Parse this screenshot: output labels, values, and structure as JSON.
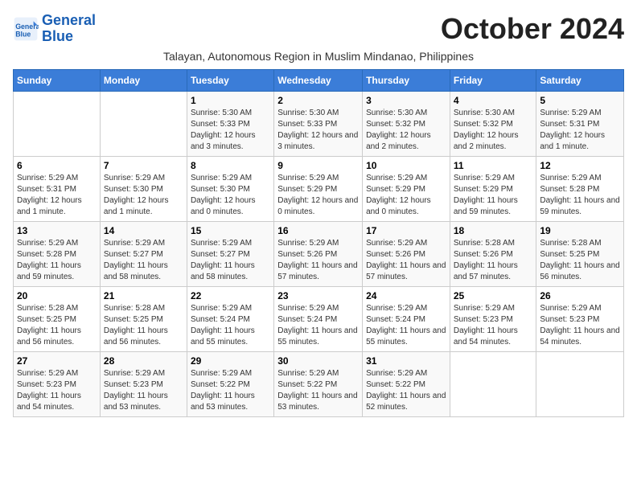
{
  "logo": {
    "line1": "General",
    "line2": "Blue"
  },
  "title": "October 2024",
  "location": "Talayan, Autonomous Region in Muslim Mindanao, Philippines",
  "headers": [
    "Sunday",
    "Monday",
    "Tuesday",
    "Wednesday",
    "Thursday",
    "Friday",
    "Saturday"
  ],
  "weeks": [
    [
      {
        "day": "",
        "info": ""
      },
      {
        "day": "",
        "info": ""
      },
      {
        "day": "1",
        "info": "Sunrise: 5:30 AM\nSunset: 5:33 PM\nDaylight: 12 hours and 3 minutes."
      },
      {
        "day": "2",
        "info": "Sunrise: 5:30 AM\nSunset: 5:33 PM\nDaylight: 12 hours and 3 minutes."
      },
      {
        "day": "3",
        "info": "Sunrise: 5:30 AM\nSunset: 5:32 PM\nDaylight: 12 hours and 2 minutes."
      },
      {
        "day": "4",
        "info": "Sunrise: 5:30 AM\nSunset: 5:32 PM\nDaylight: 12 hours and 2 minutes."
      },
      {
        "day": "5",
        "info": "Sunrise: 5:29 AM\nSunset: 5:31 PM\nDaylight: 12 hours and 1 minute."
      }
    ],
    [
      {
        "day": "6",
        "info": "Sunrise: 5:29 AM\nSunset: 5:31 PM\nDaylight: 12 hours and 1 minute."
      },
      {
        "day": "7",
        "info": "Sunrise: 5:29 AM\nSunset: 5:30 PM\nDaylight: 12 hours and 1 minute."
      },
      {
        "day": "8",
        "info": "Sunrise: 5:29 AM\nSunset: 5:30 PM\nDaylight: 12 hours and 0 minutes."
      },
      {
        "day": "9",
        "info": "Sunrise: 5:29 AM\nSunset: 5:29 PM\nDaylight: 12 hours and 0 minutes."
      },
      {
        "day": "10",
        "info": "Sunrise: 5:29 AM\nSunset: 5:29 PM\nDaylight: 12 hours and 0 minutes."
      },
      {
        "day": "11",
        "info": "Sunrise: 5:29 AM\nSunset: 5:29 PM\nDaylight: 11 hours and 59 minutes."
      },
      {
        "day": "12",
        "info": "Sunrise: 5:29 AM\nSunset: 5:28 PM\nDaylight: 11 hours and 59 minutes."
      }
    ],
    [
      {
        "day": "13",
        "info": "Sunrise: 5:29 AM\nSunset: 5:28 PM\nDaylight: 11 hours and 59 minutes."
      },
      {
        "day": "14",
        "info": "Sunrise: 5:29 AM\nSunset: 5:27 PM\nDaylight: 11 hours and 58 minutes."
      },
      {
        "day": "15",
        "info": "Sunrise: 5:29 AM\nSunset: 5:27 PM\nDaylight: 11 hours and 58 minutes."
      },
      {
        "day": "16",
        "info": "Sunrise: 5:29 AM\nSunset: 5:26 PM\nDaylight: 11 hours and 57 minutes."
      },
      {
        "day": "17",
        "info": "Sunrise: 5:29 AM\nSunset: 5:26 PM\nDaylight: 11 hours and 57 minutes."
      },
      {
        "day": "18",
        "info": "Sunrise: 5:28 AM\nSunset: 5:26 PM\nDaylight: 11 hours and 57 minutes."
      },
      {
        "day": "19",
        "info": "Sunrise: 5:28 AM\nSunset: 5:25 PM\nDaylight: 11 hours and 56 minutes."
      }
    ],
    [
      {
        "day": "20",
        "info": "Sunrise: 5:28 AM\nSunset: 5:25 PM\nDaylight: 11 hours and 56 minutes."
      },
      {
        "day": "21",
        "info": "Sunrise: 5:28 AM\nSunset: 5:25 PM\nDaylight: 11 hours and 56 minutes."
      },
      {
        "day": "22",
        "info": "Sunrise: 5:29 AM\nSunset: 5:24 PM\nDaylight: 11 hours and 55 minutes."
      },
      {
        "day": "23",
        "info": "Sunrise: 5:29 AM\nSunset: 5:24 PM\nDaylight: 11 hours and 55 minutes."
      },
      {
        "day": "24",
        "info": "Sunrise: 5:29 AM\nSunset: 5:24 PM\nDaylight: 11 hours and 55 minutes."
      },
      {
        "day": "25",
        "info": "Sunrise: 5:29 AM\nSunset: 5:23 PM\nDaylight: 11 hours and 54 minutes."
      },
      {
        "day": "26",
        "info": "Sunrise: 5:29 AM\nSunset: 5:23 PM\nDaylight: 11 hours and 54 minutes."
      }
    ],
    [
      {
        "day": "27",
        "info": "Sunrise: 5:29 AM\nSunset: 5:23 PM\nDaylight: 11 hours and 54 minutes."
      },
      {
        "day": "28",
        "info": "Sunrise: 5:29 AM\nSunset: 5:23 PM\nDaylight: 11 hours and 53 minutes."
      },
      {
        "day": "29",
        "info": "Sunrise: 5:29 AM\nSunset: 5:22 PM\nDaylight: 11 hours and 53 minutes."
      },
      {
        "day": "30",
        "info": "Sunrise: 5:29 AM\nSunset: 5:22 PM\nDaylight: 11 hours and 53 minutes."
      },
      {
        "day": "31",
        "info": "Sunrise: 5:29 AM\nSunset: 5:22 PM\nDaylight: 11 hours and 52 minutes."
      },
      {
        "day": "",
        "info": ""
      },
      {
        "day": "",
        "info": ""
      }
    ]
  ]
}
